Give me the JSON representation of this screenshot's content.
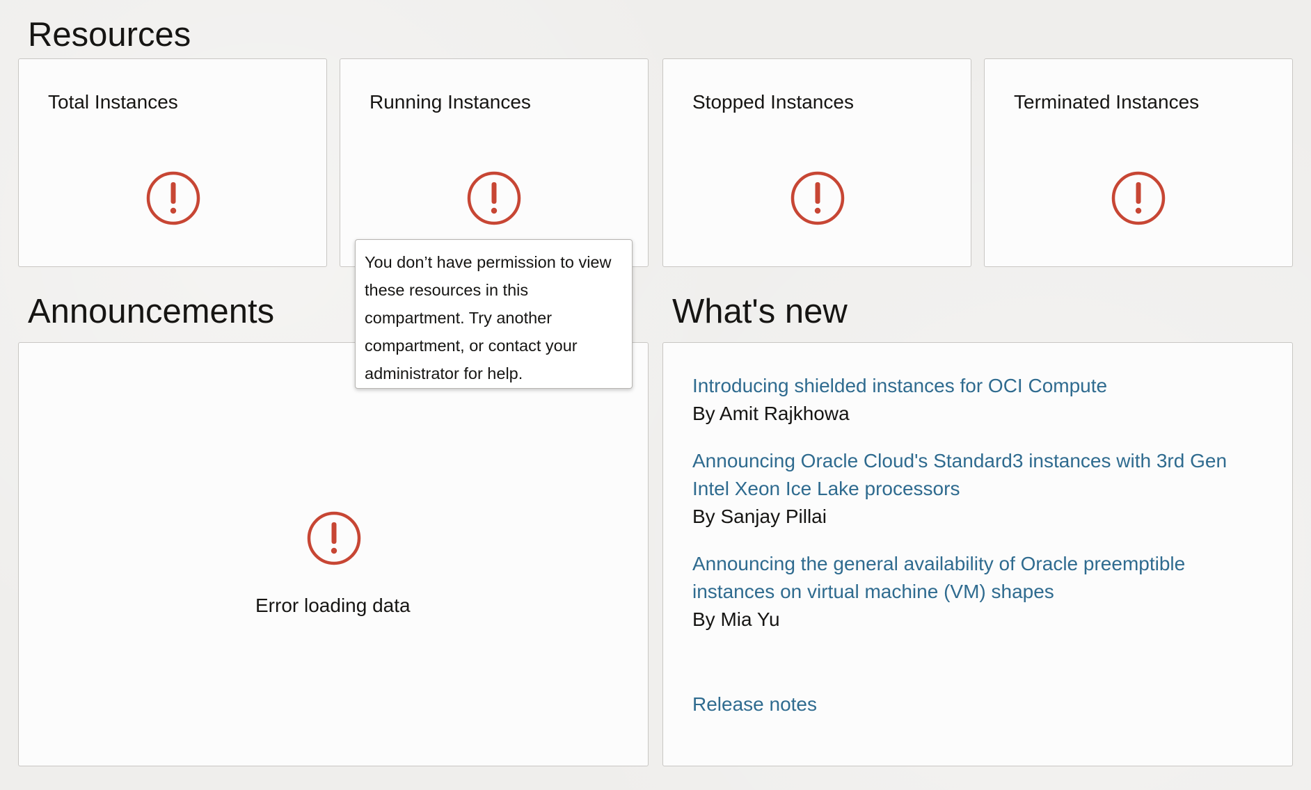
{
  "resources": {
    "heading": "Resources",
    "cards": [
      {
        "title": "Total Instances"
      },
      {
        "title": "Running Instances"
      },
      {
        "title": "Stopped Instances"
      },
      {
        "title": "Terminated Instances"
      }
    ]
  },
  "tooltip": {
    "text": "You don’t have permission to view these resources in this compartment. Try another compartment, or contact your administrator for help."
  },
  "announcements": {
    "heading": "Announcements",
    "error_text": "Error loading data"
  },
  "whats_new": {
    "heading": "What's new",
    "items": [
      {
        "title": "Introducing shielded instances for OCI Compute",
        "author": "By Amit Rajkhowa"
      },
      {
        "title": "Announcing Oracle Cloud's Standard3 instances with 3rd Gen Intel Xeon Ice Lake processors",
        "author": "By Sanjay Pillai"
      },
      {
        "title": "Announcing the general availability of Oracle preemptible instances on virtual machine (VM) shapes",
        "author": "By Mia Yu"
      }
    ],
    "release_notes_label": "Release notes"
  },
  "colors": {
    "alert": "#c74634",
    "link": "#2f6b8f",
    "background": "#efeeec",
    "card": "#fcfcfc"
  },
  "icons": {
    "alert": "alert-circle-icon"
  }
}
